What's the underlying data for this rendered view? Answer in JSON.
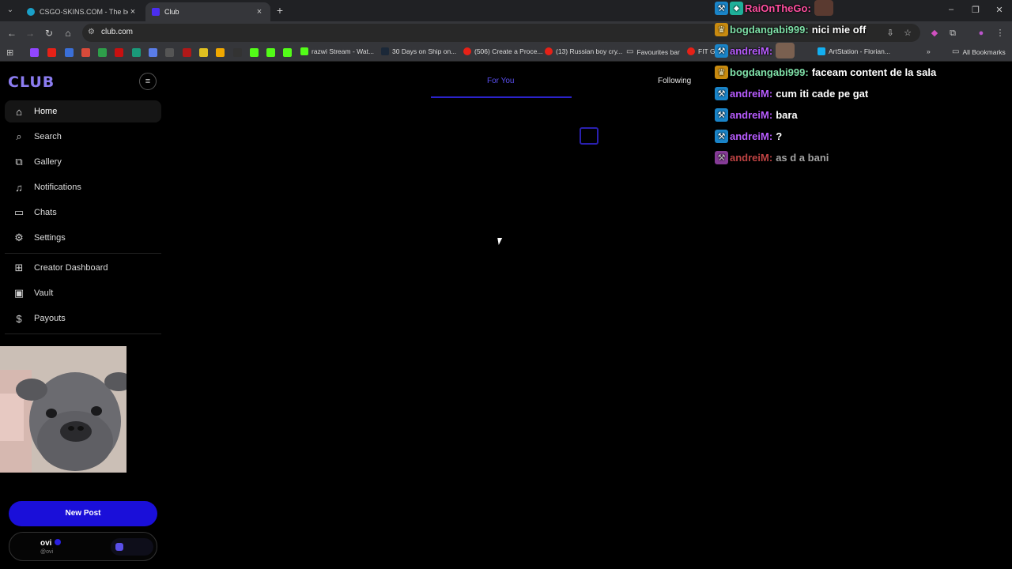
{
  "browser": {
    "tabs": [
      {
        "title": "CSGO-SKINS.COM - The best C",
        "active": false
      },
      {
        "title": "Club",
        "active": true
      }
    ],
    "url": "club.com",
    "bookmarks": [
      {
        "label": "razwi Stream - Wat..."
      },
      {
        "label": "30 Days on Ship on..."
      },
      {
        "label": "(506) Create a Proce..."
      },
      {
        "label": "(13) Russian boy cry..."
      },
      {
        "label": "Favourites bar"
      },
      {
        "label": "FIT GI"
      },
      {
        "label": "ArtStation - Florian..."
      }
    ],
    "all_bookmarks": "All Bookmarks"
  },
  "app": {
    "logo": "CLUB",
    "nav": [
      {
        "label": "Home",
        "icon": "home-icon"
      },
      {
        "label": "Search",
        "icon": "search-icon"
      },
      {
        "label": "Gallery",
        "icon": "gallery-icon"
      },
      {
        "label": "Notifications",
        "icon": "bell-icon"
      },
      {
        "label": "Chats",
        "icon": "chat-icon"
      },
      {
        "label": "Settings",
        "icon": "gear-icon"
      },
      {
        "label": "Creator Dashboard",
        "icon": "dashboard-icon"
      },
      {
        "label": "Vault",
        "icon": "vault-icon"
      },
      {
        "label": "Payouts",
        "icon": "dollar-icon"
      }
    ],
    "new_post": "New Post",
    "user": {
      "name": "ovi",
      "handle": "@ovi"
    },
    "feed_tabs": {
      "for_you": "For You",
      "following": "Following"
    }
  },
  "chat": [
    {
      "user": "RaiOnTheGo",
      "message": "",
      "color": "#ff4fa0",
      "badges": [
        "hammer",
        "vip"
      ]
    },
    {
      "user": "bogdangabi999",
      "message": "nici mie off",
      "color": "#7fe0a8",
      "badges": [
        "crown"
      ]
    },
    {
      "user": "andreiM",
      "message": "",
      "color": "#b85cff",
      "badges": [
        "hammer"
      ]
    },
    {
      "user": "bogdangabi999",
      "message": "faceam content de la sala",
      "color": "#7fe0a8",
      "badges": [
        "crown"
      ]
    },
    {
      "user": "andreiM",
      "message": "cum iti cade pe gat",
      "color": "#b85cff",
      "badges": [
        "hammer"
      ]
    },
    {
      "user": "andreiM",
      "message": "bara",
      "color": "#b85cff",
      "badges": [
        "hammer"
      ]
    },
    {
      "user": "andreiM",
      "message": "?",
      "color": "#b85cff",
      "badges": [
        "hammer"
      ]
    },
    {
      "user": "andreiM",
      "message": "as d a bani",
      "color": "#ff5a5a",
      "badges": [
        "mod-pink"
      ]
    }
  ]
}
